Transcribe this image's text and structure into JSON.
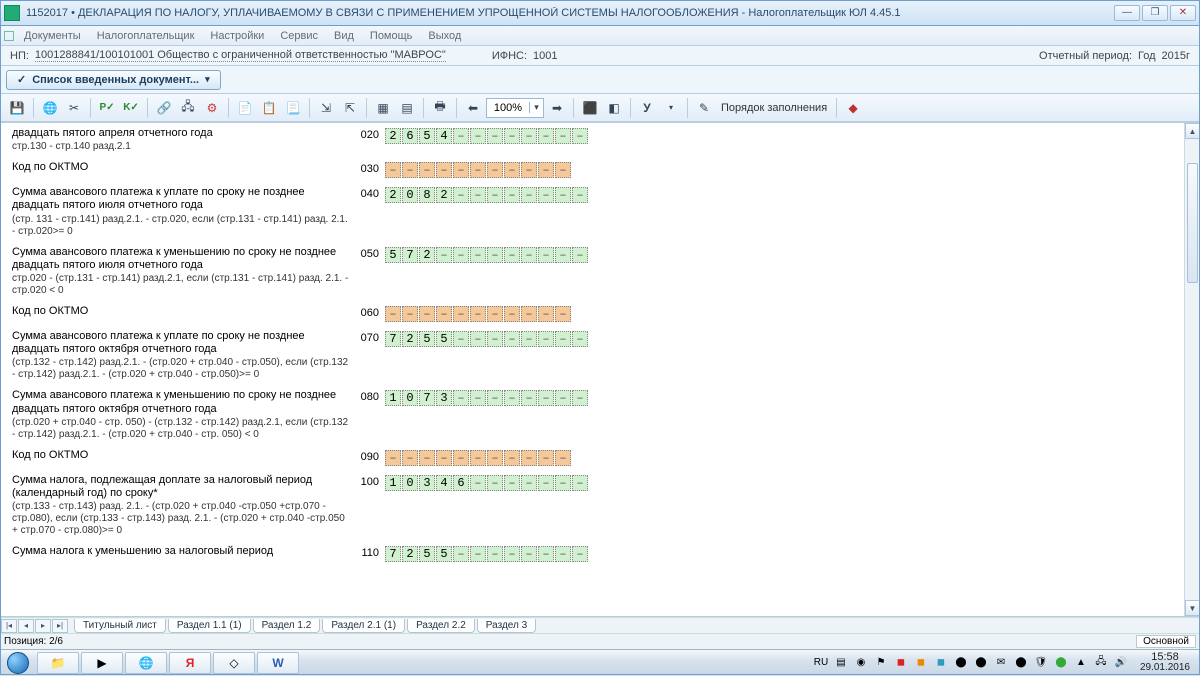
{
  "window": {
    "title": "1152017 • ДЕКЛАРАЦИЯ ПО НАЛОГУ, УПЛАЧИВАЕМОМУ В СВЯЗИ С ПРИМЕНЕНИЕМ УПРОЩЕННОЙ СИСТЕМЫ НАЛОГООБЛОЖЕНИЯ - Налогоплательщик ЮЛ 4.45.1"
  },
  "menu": {
    "items": [
      "Документы",
      "Налогоплательщик",
      "Настройки",
      "Сервис",
      "Вид",
      "Помощь",
      "Выход"
    ]
  },
  "info": {
    "np_label": "НП:",
    "np_value": "1001288841/100101001 Общество с ограниченной ответственностью \"МАВРОС\"",
    "ifns_label": "ИФНС:",
    "ifns_value": "1001",
    "period_label": "Отчетный период:",
    "period_type": "Год",
    "period_year": "2015г"
  },
  "doclist_btn": "Список введенных документ...",
  "toolbar": {
    "zoom": "100%",
    "order_label": "Порядок заполнения"
  },
  "rows": [
    {
      "desc": "двадцать пятого апреля отчетного года",
      "hint": "стр.130 - стр.140 разд.2.1",
      "code": "020",
      "cells": [
        "2",
        "6",
        "5",
        "4",
        "-",
        "-",
        "-",
        "-",
        "-",
        "-",
        "-",
        "-"
      ],
      "color": "g"
    },
    {
      "desc": "Код по ОКТМО",
      "hint": "",
      "code": "030",
      "cells": [
        "-",
        "-",
        "-",
        "-",
        "-",
        "-",
        "-",
        "-",
        "-",
        "-",
        "-"
      ],
      "color": "o"
    },
    {
      "desc": "Сумма  авансового платежа к уплате по сроку не позднее двадцать пятого июля отчетного года",
      "hint": "(стр. 131 - стр.141) разд.2.1. - стр.020,\nесли (стр.131 - стр.141) разд. 2.1. - стр.020>= 0",
      "code": "040",
      "cells": [
        "2",
        "0",
        "8",
        "2",
        "-",
        "-",
        "-",
        "-",
        "-",
        "-",
        "-",
        "-"
      ],
      "color": "g"
    },
    {
      "desc": "Сумма  авансового платежа к уменьшению по сроку не позднее двадцать пятого июля отчетного года",
      "hint": "стр.020 - (стр.131 - стр.141) разд.2.1,\nесли (стр.131 - стр.141) разд. 2.1. - стр.020 < 0",
      "code": "050",
      "cells": [
        "5",
        "7",
        "2",
        "-",
        "-",
        "-",
        "-",
        "-",
        "-",
        "-",
        "-",
        "-"
      ],
      "color": "g"
    },
    {
      "desc": "Код по ОКТМО",
      "hint": "",
      "code": "060",
      "cells": [
        "-",
        "-",
        "-",
        "-",
        "-",
        "-",
        "-",
        "-",
        "-",
        "-",
        "-"
      ],
      "color": "o"
    },
    {
      "desc": "Сумма авансового платежа к уплате по сроку не позднее двадцать пятого октября отчетного года",
      "hint": "(стр.132 - стр.142) разд.2.1. - (стр.020 + стр.040 - стр.050),\nесли (стр.132 - стр.142) разд.2.1. - (стр.020 + стр.040 - стр.050)>= 0",
      "code": "070",
      "cells": [
        "7",
        "2",
        "5",
        "5",
        "-",
        "-",
        "-",
        "-",
        "-",
        "-",
        "-",
        "-"
      ],
      "color": "g"
    },
    {
      "desc": "Сумма авансового платежа к уменьшению по сроку не позднее двадцать пятого октября отчетного года",
      "hint": "(стр.020 + стр.040 - стр. 050) - (стр.132 - стр.142) разд.2.1,\nесли (стр.132 - стр.142) разд.2.1. - (стр.020 + стр.040 - стр. 050) < 0",
      "code": "080",
      "cells": [
        "1",
        "0",
        "7",
        "3",
        "-",
        "-",
        "-",
        "-",
        "-",
        "-",
        "-",
        "-"
      ],
      "color": "g"
    },
    {
      "desc": "Код по ОКТМО",
      "hint": "",
      "code": "090",
      "cells": [
        "-",
        "-",
        "-",
        "-",
        "-",
        "-",
        "-",
        "-",
        "-",
        "-",
        "-"
      ],
      "color": "o"
    },
    {
      "desc": "Сумма налога, подлежащая доплате за налоговый период (календарный год) по сроку*",
      "hint": "(стр.133 - стр.143) разд. 2.1. - (стр.020 + стр.040 -стр.050 +стр.070 - стр.080),\nесли (стр.133 - стр.143) разд. 2.1. - (стр.020 + стр.040 -стр.050 + стр.070 - стр.080)>= 0",
      "code": "100",
      "cells": [
        "1",
        "0",
        "3",
        "4",
        "6",
        "-",
        "-",
        "-",
        "-",
        "-",
        "-",
        "-"
      ],
      "color": "g"
    },
    {
      "desc": "Сумма налога к уменьшению за налоговый период",
      "hint": "",
      "code": "110",
      "cells": [
        "7",
        "2",
        "5",
        "5",
        "-",
        "-",
        "-",
        "-",
        "-",
        "-",
        "-",
        "-"
      ],
      "color": "g"
    }
  ],
  "tabs": [
    "Титульный лист",
    "Раздел 1.1 (1)",
    "Раздел 1.2",
    "Раздел 2.1 (1)",
    "Раздел 2.2",
    "Раздел 3"
  ],
  "active_tab": 1,
  "status": {
    "left": "Позиция: 2/6",
    "right": "Основной"
  },
  "tray": {
    "lang": "RU",
    "time": "15:58",
    "date": "29.01.2016"
  }
}
